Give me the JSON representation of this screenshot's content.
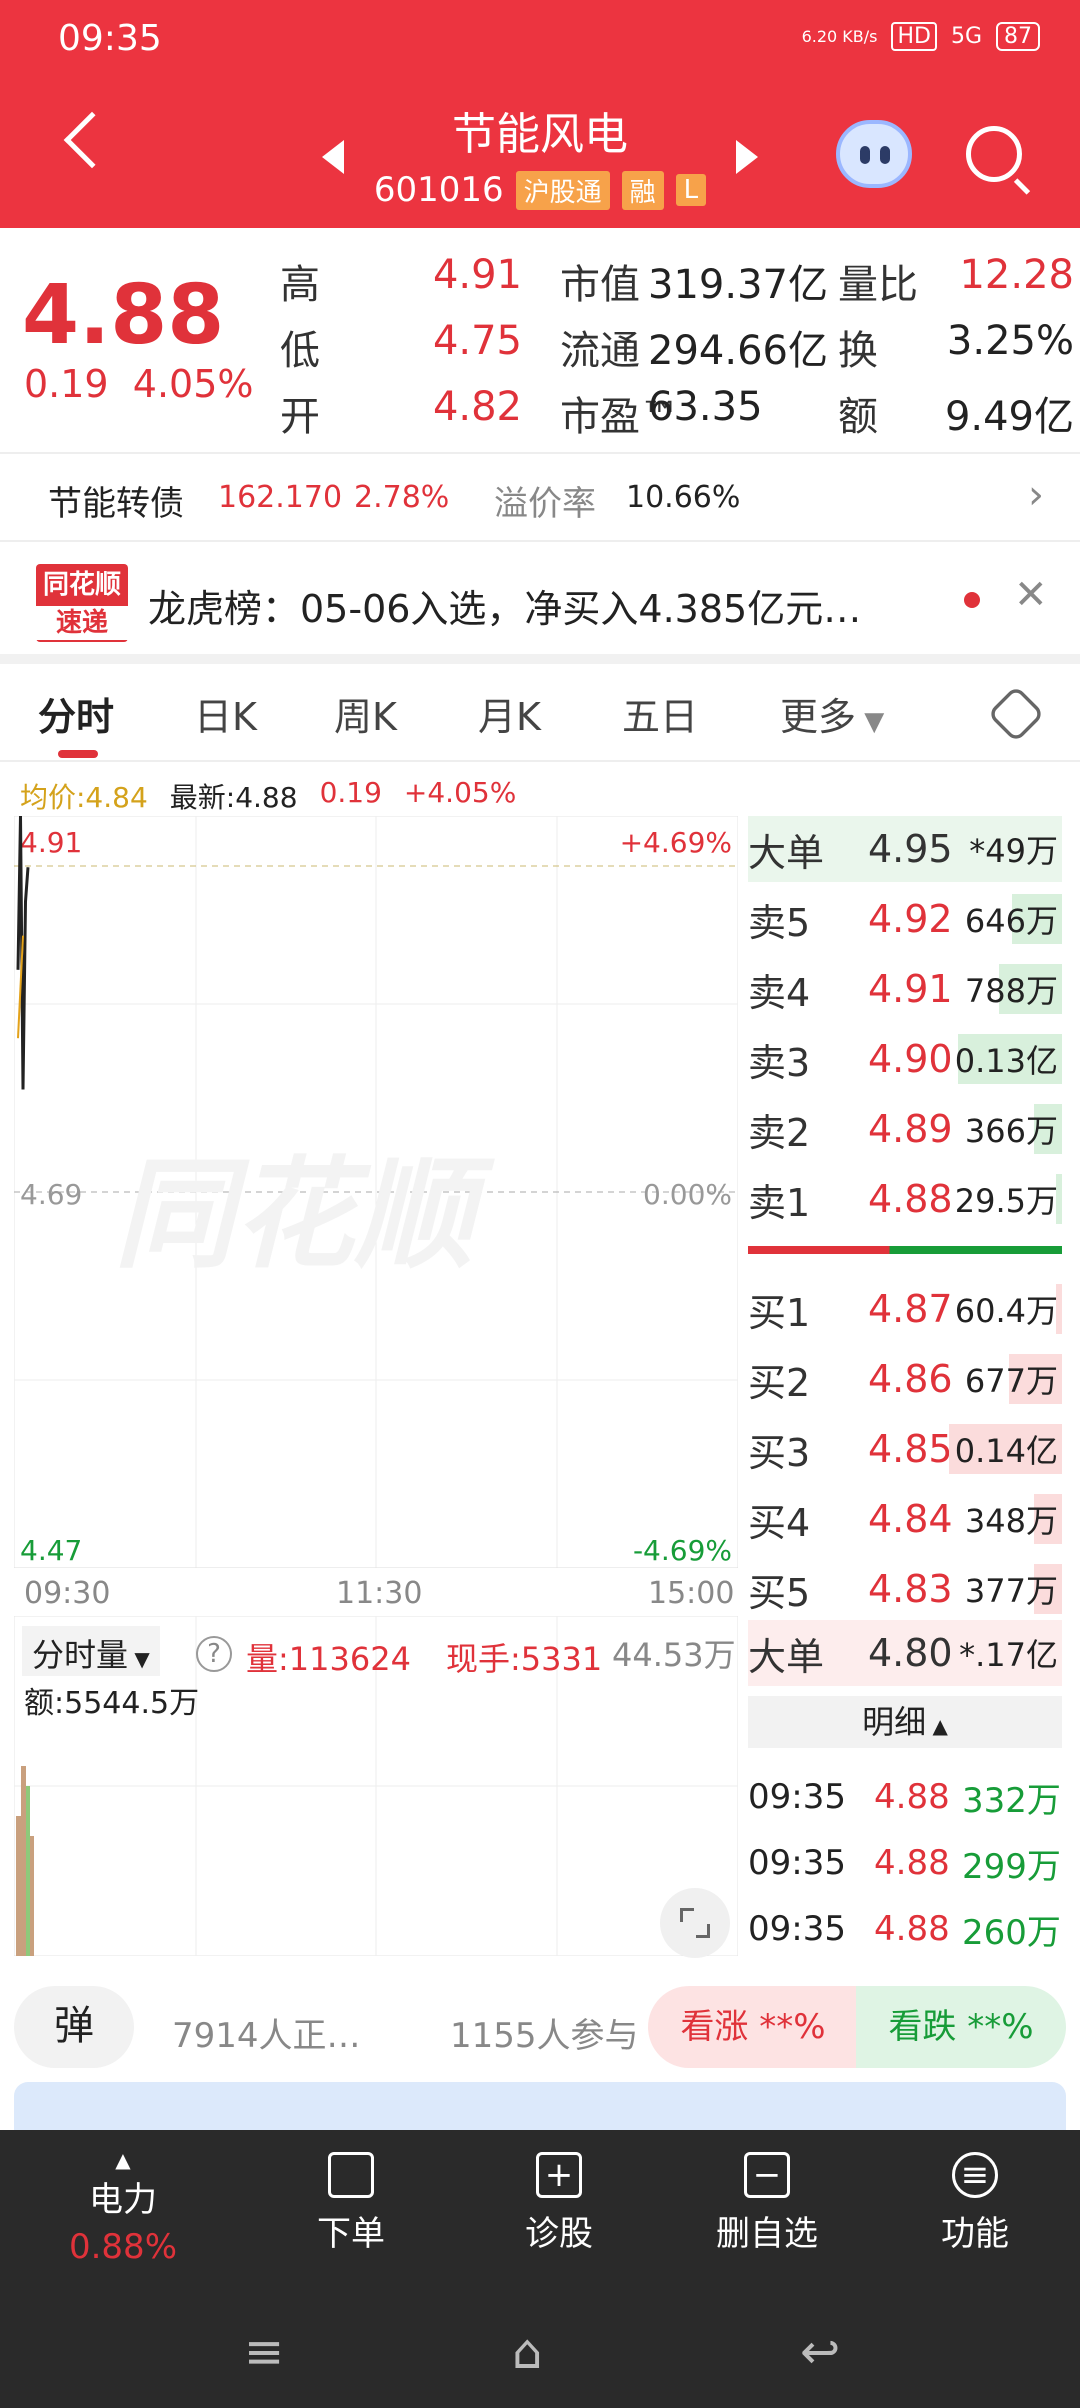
{
  "status": {
    "time": "09:35",
    "net_speed": "6.20 KB/s",
    "hd": "HD",
    "signal": "5G",
    "battery": "87"
  },
  "header": {
    "title": "节能风电",
    "code": "601016",
    "tags": [
      "沪股通",
      "融",
      "L"
    ]
  },
  "quote": {
    "price": "4.88",
    "change": "0.19",
    "change_pct": "4.05%",
    "grid": [
      [
        {
          "label": "高",
          "value": "4.91",
          "color": "red"
        },
        {
          "label": "市值",
          "value": "319.37亿",
          "color": "dark"
        },
        {
          "label": "量比",
          "value": "12.28",
          "color": "red"
        }
      ],
      [
        {
          "label": "低",
          "value": "4.75",
          "color": "red"
        },
        {
          "label": "流通",
          "value": "294.66亿",
          "color": "dark"
        },
        {
          "label": "换",
          "value": "3.25%",
          "color": "dark"
        }
      ],
      [
        {
          "label": "开",
          "value": "4.82",
          "color": "red"
        },
        {
          "label": "市盈™",
          "value": "63.35",
          "color": "dark"
        },
        {
          "label": "额",
          "value": "9.49亿",
          "color": "dark"
        }
      ]
    ]
  },
  "bond": {
    "name": "节能转债",
    "price": "162.170",
    "pct": "2.78%",
    "premium_label": "溢价率",
    "premium": "10.66%"
  },
  "lhb": {
    "logo_top": "同花顺",
    "logo_bottom": "速递",
    "text": "龙虎榜：05-06入选，净买入4.385亿元…"
  },
  "tabs": [
    "分时",
    "日K",
    "周K",
    "月K",
    "五日",
    "更多"
  ],
  "chart_info": {
    "avg": "均价:4.84",
    "latest": "最新:4.88",
    "chg": "0.19",
    "pct": "+4.05%"
  },
  "chart_data": {
    "type": "line",
    "title": "",
    "y_left": {
      "top": "4.91",
      "mid": "4.69",
      "bottom": "4.47"
    },
    "y_right": {
      "top": "+4.69%",
      "mid": "0.00%",
      "bottom": "-4.69%"
    },
    "x_labels": [
      "09:30",
      "11:30",
      "15:00"
    ],
    "ylim": [
      4.47,
      4.91
    ],
    "price_series": [
      4.82,
      4.91,
      4.75,
      4.86,
      4.88
    ],
    "avg_series": [
      4.78,
      4.81,
      4.84
    ],
    "watermark": "同花顺"
  },
  "vol": {
    "selector": "分时量",
    "help": "?",
    "vol": "量:113624",
    "now": "现手:5331",
    "max": "44.53万",
    "amount": "额:5544.5万"
  },
  "book": {
    "big_sell": {
      "label": "大单",
      "price": "4.95",
      "vol": "*49万"
    },
    "sells": [
      {
        "label": "卖5",
        "price": "4.92",
        "vol": "646万",
        "bar": 0.16
      },
      {
        "label": "卖4",
        "price": "4.91",
        "vol": "788万",
        "bar": 0.2
      },
      {
        "label": "卖3",
        "price": "4.90",
        "vol": "0.13亿",
        "bar": 0.33
      },
      {
        "label": "卖2",
        "price": "4.89",
        "vol": "366万",
        "bar": 0.09
      },
      {
        "label": "卖1",
        "price": "4.88",
        "vol": "29.5万",
        "bar": 0.01
      }
    ],
    "buys": [
      {
        "label": "买1",
        "price": "4.87",
        "vol": "60.4万",
        "bar": 0.02
      },
      {
        "label": "买2",
        "price": "4.86",
        "vol": "677万",
        "bar": 0.17
      },
      {
        "label": "买3",
        "price": "4.85",
        "vol": "0.14亿",
        "bar": 0.36
      },
      {
        "label": "买4",
        "price": "4.84",
        "vol": "348万",
        "bar": 0.09
      },
      {
        "label": "买5",
        "price": "4.83",
        "vol": "377万",
        "bar": 0.09
      }
    ],
    "big_buy": {
      "label": "大单",
      "price": "4.80",
      "vol": "*.17亿"
    },
    "detail_label": "明细",
    "ticks": [
      {
        "time": "09:35",
        "price": "4.88",
        "vol": "332万"
      },
      {
        "time": "09:35",
        "price": "4.88",
        "vol": "299万"
      },
      {
        "time": "09:35",
        "price": "4.88",
        "vol": "260万"
      }
    ]
  },
  "social": {
    "danmu": "弹",
    "watching": "7914人正…",
    "participants": "1155人参与",
    "bull": "看涨 **%",
    "bear": "看跌 **%"
  },
  "nav": [
    {
      "label": "电力",
      "sub": "0.88%"
    },
    {
      "label": "下单"
    },
    {
      "label": "诊股"
    },
    {
      "label": "删自选"
    },
    {
      "label": "功能"
    }
  ]
}
